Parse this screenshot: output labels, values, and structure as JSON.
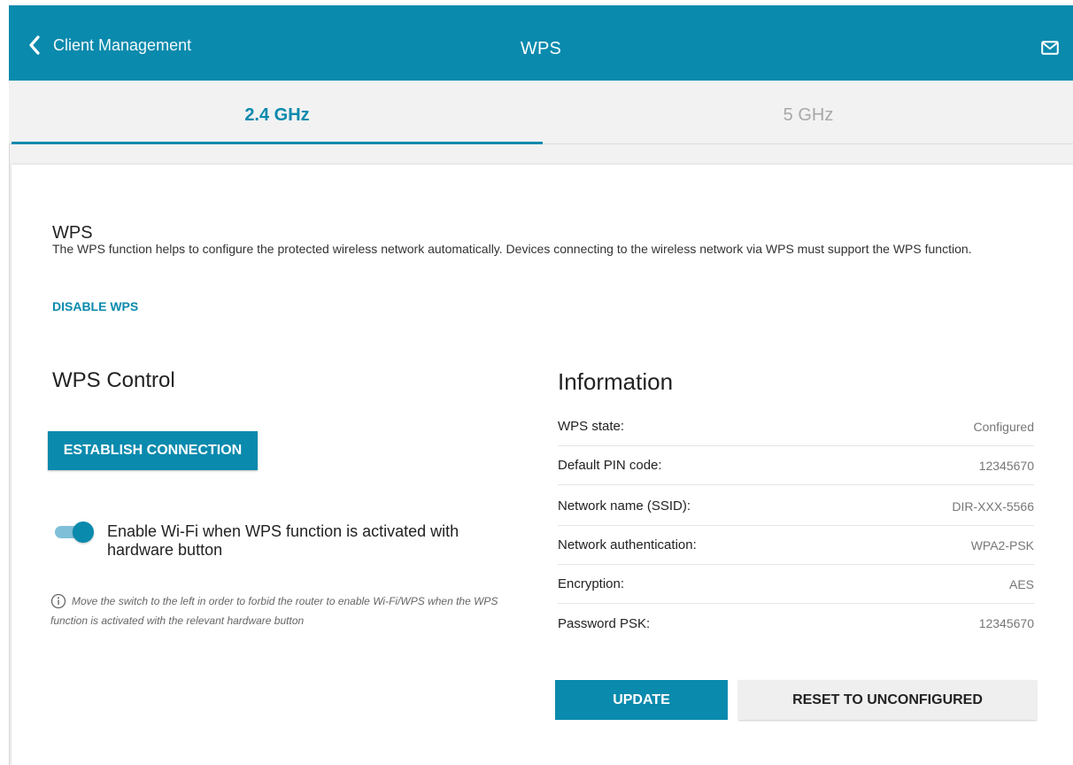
{
  "header": {
    "back_label": "Client Management",
    "title": "WPS",
    "back_icon": "chevron-left-icon",
    "mail_icon": "mail-icon",
    "accent": "#0a8aad"
  },
  "tabs": [
    {
      "label": "2.4 GHz",
      "active": true
    },
    {
      "label": "5 GHz",
      "active": false
    }
  ],
  "wps": {
    "heading": "WPS",
    "description": "The WPS function helps to configure the protected wireless network automatically. Devices connecting to the wireless network via WPS must support the WPS function.",
    "disable_link": "DISABLE WPS"
  },
  "control": {
    "heading": "WPS Control",
    "establish_button": "ESTABLISH CONNECTION",
    "toggle_label": "Enable Wi-Fi when WPS function is activated with hardware button",
    "toggle_on": true,
    "hint": "Move the switch to the left in order to forbid the router to enable Wi-Fi/WPS when the WPS function is activated with the relevant hardware button",
    "hint_icon": "info-icon"
  },
  "information": {
    "heading": "Information",
    "rows": [
      {
        "key": "WPS state:",
        "value": "Configured"
      },
      {
        "key": "Default PIN code:",
        "value": "12345670"
      },
      {
        "key": "Network name (SSID):",
        "value": "DIR-XXX-5566"
      },
      {
        "key": "Network authentication:",
        "value": "WPA2-PSK"
      },
      {
        "key": "Encryption:",
        "value": "AES"
      },
      {
        "key": "Password PSK:",
        "value": "12345670"
      }
    ]
  },
  "actions": {
    "update_label": "UPDATE",
    "reset_label": "RESET TO UNCONFIGURED"
  }
}
